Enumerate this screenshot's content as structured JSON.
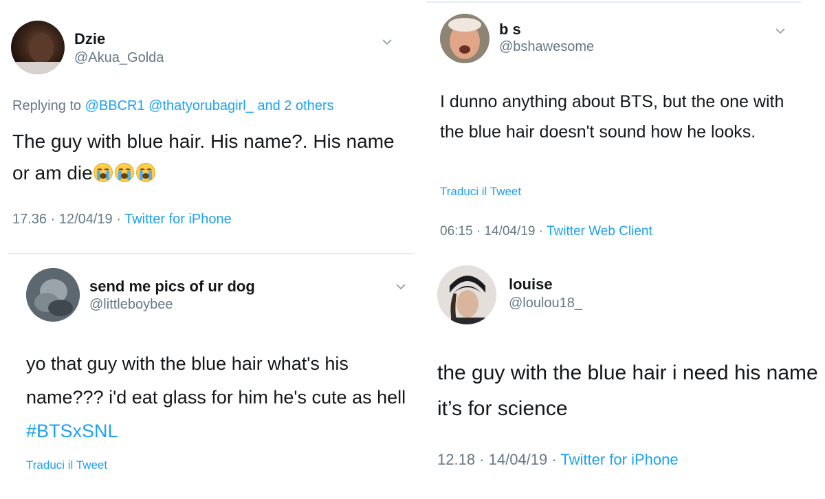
{
  "tweets": [
    {
      "name": "Dzie",
      "handle": "@Akua_Golda",
      "reply_prefix": "Replying to ",
      "reply_targets": "@BBCR1 @thatyorubagirl_ and 2 others",
      "text": "The guy with blue hair. His name?. His name or am die",
      "emoji": [
        "crying-face",
        "crying-face",
        "crying-face"
      ],
      "time": "17.36 · 12/04/19 · ",
      "source": "Twitter for iPhone"
    },
    {
      "name": "b s",
      "handle": "@bshawesome",
      "text": "I dunno anything about BTS, but the one with the blue hair doesn't sound how he looks.",
      "translate": "Traduci il Tweet",
      "time": "06:15 · 14/04/19 · ",
      "source": "Twitter Web Client"
    },
    {
      "name": "send me pics of ur dog",
      "handle": "@littleboybee",
      "text": "yo that guy with the blue hair what's his name??? i'd eat glass for him he's cute as hell ",
      "hashtag": "#BTSxSNL",
      "translate": "Traduci il Tweet"
    },
    {
      "name": "louise",
      "handle": "@loulou18_",
      "text": "the guy with the blue hair i need his name it’s for science",
      "time": "12.18 · 14/04/19 · ",
      "source": "Twitter for iPhone"
    }
  ],
  "colors": {
    "link": "#1da1f2",
    "secondary": "#657786",
    "divider": "#e6ecf0"
  },
  "icons": [
    "chevron-down-icon"
  ]
}
